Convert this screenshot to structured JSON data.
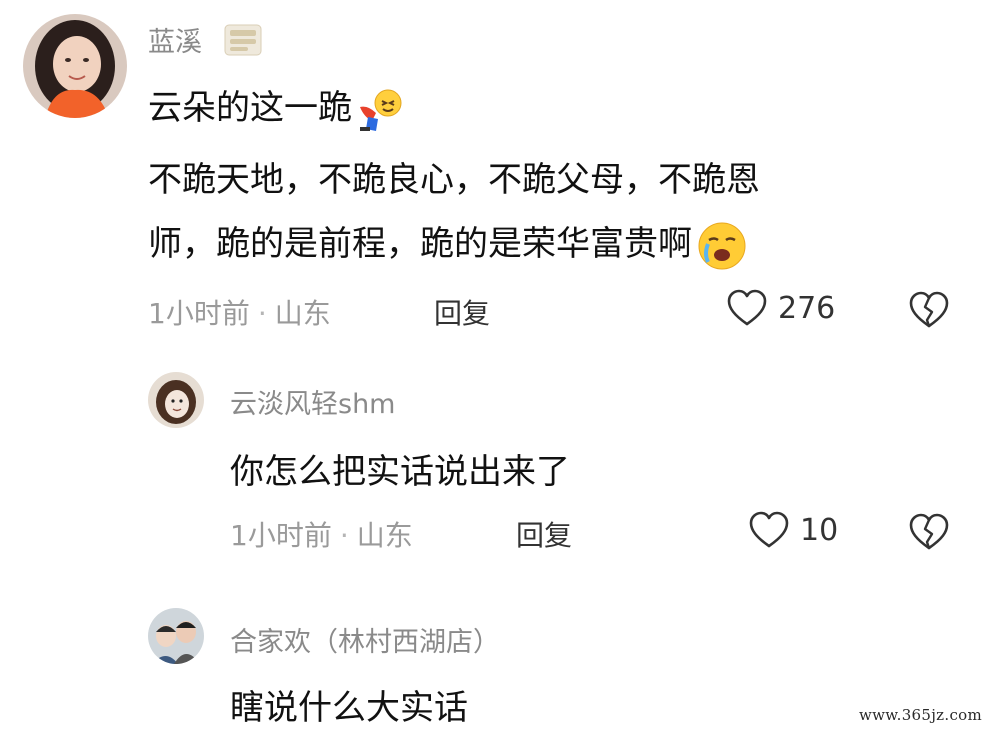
{
  "comments": [
    {
      "user": "蓝溪",
      "text_lines": [
        "云朵的这一跪",
        "不跪天地，不跪良心，不跪父母，不跪恩",
        "师，跪的是前程，跪的是荣华富贵啊"
      ],
      "time": "1小时前",
      "location": "山东",
      "reply_label": "回复",
      "likes": "276"
    },
    {
      "user": "云淡风轻shm",
      "text": "你怎么把实话说出来了",
      "time": "1小时前",
      "location": "山东",
      "reply_label": "回复",
      "likes": "10"
    },
    {
      "user": "合家欢（林村西湖店）",
      "text": "瞎说什么大实话"
    }
  ],
  "separator": "·",
  "watermark": "www.365jz.com",
  "icons": {
    "like": "heart-outline-icon",
    "dislike": "broken-heart-icon",
    "emoji_1": "kneeling-person-emoji",
    "emoji_2": "crying-face-emoji",
    "badge": "fan-badge-icon"
  }
}
